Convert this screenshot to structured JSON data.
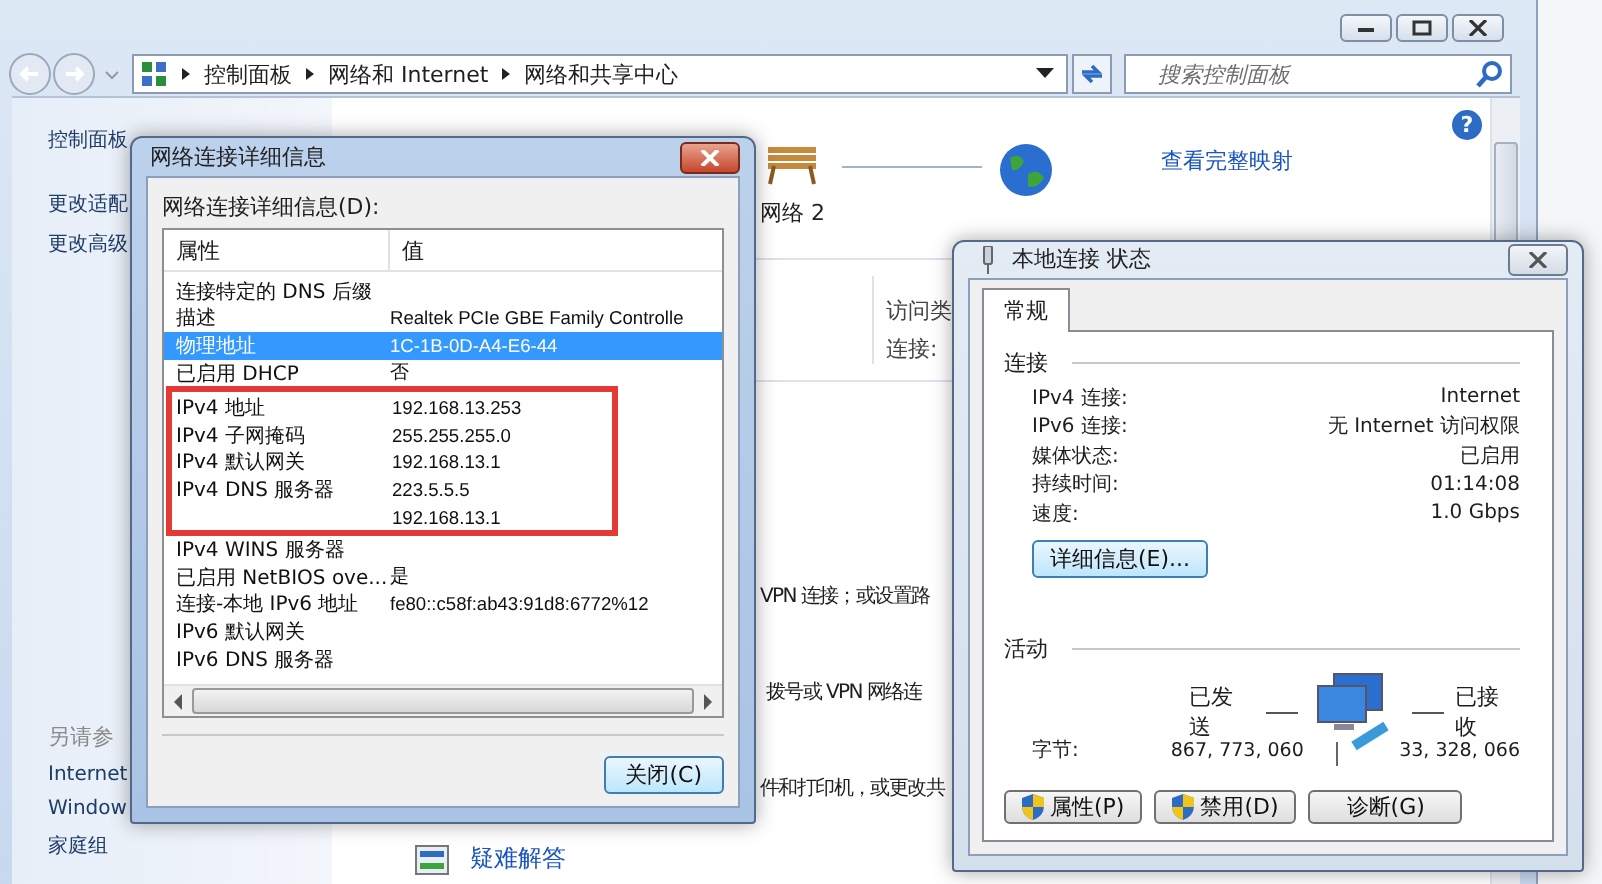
{
  "explorer": {
    "breadcrumb": [
      "控制面板",
      "网络和 Internet",
      "网络和共享中心"
    ],
    "search": {
      "placeholder": "搜索控制面板"
    },
    "help_button": "?",
    "sidebar": {
      "items": [
        "控制面板",
        "更改适配",
        "更改高级"
      ],
      "see_also_heading": "另请参",
      "see_also": [
        "Internet",
        "Window",
        "家庭组"
      ]
    },
    "network_map": {
      "network_name": "网络 2",
      "full_map_link": "查看完整映射"
    },
    "network_details": [
      "访问类",
      "连接:"
    ],
    "tasks": [
      "VPN 连接；或设置路",
      "拨号或 VPN 网络连",
      "件和打印机，或更改共"
    ],
    "troubleshoot_link": "疑难解答"
  },
  "details_dialog": {
    "title": "网络连接详细信息",
    "list_label": "网络连接详细信息(D):",
    "columns": [
      "属性",
      "值"
    ],
    "rows": [
      {
        "property": "连接特定的 DNS 后缀",
        "value": "",
        "selected": false,
        "highlighted": false
      },
      {
        "property": "描述",
        "value": "Realtek PCIe GBE Family Controlle",
        "selected": false,
        "highlighted": false
      },
      {
        "property": "物理地址",
        "value": "1C-1B-0D-A4-E6-44",
        "selected": true,
        "highlighted": false
      },
      {
        "property": "已启用 DHCP",
        "value": "否",
        "selected": false,
        "highlighted": false
      },
      {
        "property": "IPv4 地址",
        "value": "192.168.13.253",
        "selected": false,
        "highlighted": true
      },
      {
        "property": "IPv4 子网掩码",
        "value": "255.255.255.0",
        "selected": false,
        "highlighted": true
      },
      {
        "property": "IPv4 默认网关",
        "value": "192.168.13.1",
        "selected": false,
        "highlighted": true
      },
      {
        "property": "IPv4 DNS 服务器",
        "value": "223.5.5.5",
        "selected": false,
        "highlighted": true
      },
      {
        "property": "",
        "value": "192.168.13.1",
        "selected": false,
        "highlighted": true
      },
      {
        "property": "IPv4 WINS 服务器",
        "value": "",
        "selected": false,
        "highlighted": false
      },
      {
        "property": "已启用 NetBIOS ove...",
        "value": "是",
        "selected": false,
        "highlighted": false
      },
      {
        "property": "连接-本地 IPv6 地址",
        "value": "fe80::c58f:ab43:91d8:6772%12",
        "selected": false,
        "highlighted": false
      },
      {
        "property": "IPv6 默认网关",
        "value": "",
        "selected": false,
        "highlighted": false
      },
      {
        "property": "IPv6 DNS 服务器",
        "value": "",
        "selected": false,
        "highlighted": false
      }
    ],
    "close_button": "关闭(C)"
  },
  "status_dialog": {
    "title": "本地连接 状态",
    "tabs": [
      {
        "label": "常规",
        "selected": true
      }
    ],
    "connection_heading": "连接",
    "connection": [
      {
        "label": "IPv4 连接:",
        "value": "Internet"
      },
      {
        "label": "IPv6 连接:",
        "value": "无 Internet 访问权限"
      },
      {
        "label": "媒体状态:",
        "value": "已启用"
      },
      {
        "label": "持续时间:",
        "value": "01:14:08"
      },
      {
        "label": "速度:",
        "value": "1.0 Gbps"
      }
    ],
    "details_button": "详细信息(E)...",
    "activity_heading": "活动",
    "sent_label": "已发送",
    "received_label": "已接收",
    "bytes_label": "字节:",
    "bytes_sent": "867, 773, 060",
    "bytes_received": "33, 328, 066",
    "buttons": [
      {
        "label": "属性(P)",
        "kind": "shield"
      },
      {
        "label": "禁用(D)",
        "kind": "shield"
      },
      {
        "label": "诊断(G)",
        "kind": "plain"
      }
    ]
  }
}
